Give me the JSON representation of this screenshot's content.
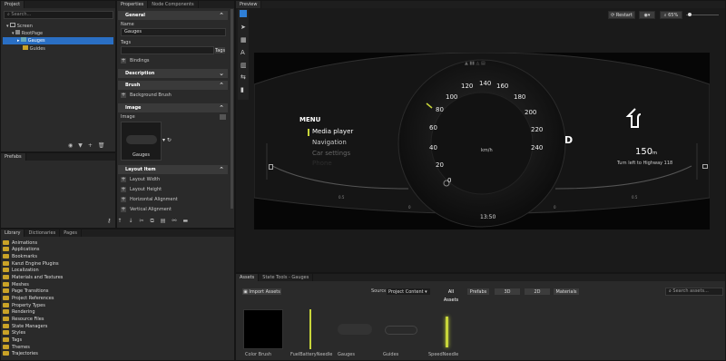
{
  "project": {
    "tab": "Project",
    "search_placeholder": "Search...",
    "tree": [
      {
        "label": "Screen"
      },
      {
        "label": "RootPage"
      },
      {
        "label": "Gauges"
      },
      {
        "label": "Guides"
      }
    ],
    "prefabs_tab": "Prefabs"
  },
  "properties": {
    "tabs": [
      "Properties",
      "Node Components"
    ],
    "general_header": "General",
    "name_label": "Name",
    "name_value": "Gauges",
    "tags_label": "Tags",
    "tags_button": "Tags",
    "bindings": "Bindings",
    "description_header": "Description",
    "brush_header": "Brush",
    "background_brush": "Background Brush",
    "image_header": "Image",
    "image_label": "Image",
    "image_value": "Gauges",
    "layout_header": "Layout Item",
    "layout_items": [
      "Layout Width",
      "Layout Height",
      "Horizontal Alignment",
      "Vertical Alignment"
    ]
  },
  "preview": {
    "tab": "Preview",
    "restart": "Restart",
    "zoom": "65%",
    "menu_title": "MENU",
    "menu_items": [
      "Media player",
      "Navigation",
      "Car settings",
      "Phone"
    ],
    "speed_ticks": [
      "0",
      "20",
      "40",
      "60",
      "80",
      "100",
      "120",
      "140",
      "160",
      "180",
      "200",
      "220",
      "240"
    ],
    "unit": "km/h",
    "gear": "D",
    "nav_distance": "150",
    "nav_unit": "m",
    "nav_text": "Turn left to Highway 118",
    "clock": "13:50",
    "left_scale": [
      "0.5",
      "0"
    ],
    "right_scale": [
      "0.5",
      "0"
    ]
  },
  "library": {
    "tabs": [
      "Library",
      "Dictionaries",
      "Pages"
    ],
    "items": [
      "Animations",
      "Applications",
      "Bookmarks",
      "Kanzi Engine Plugins",
      "Localization",
      "Materials and Textures",
      "Meshes",
      "Page Transitions",
      "Project References",
      "Property Types",
      "Rendering",
      "Resource Files",
      "State Managers",
      "Styles",
      "Tags",
      "Themes",
      "Trajectories"
    ]
  },
  "assets": {
    "tabs": [
      "Assets",
      "State Tools - Gauges"
    ],
    "import": "Import Assets",
    "source_label": "Source",
    "source_value": "Project Content",
    "filters": [
      "All Assets",
      "Prefabs",
      "3D",
      "2D",
      "Materials"
    ],
    "search_placeholder": "Search assets...",
    "items": [
      "Color Brush",
      "FuelBatteryNeedle",
      "Gauges",
      "Guides",
      "SpeedNeedle"
    ]
  },
  "colors": {
    "accent": "#2f7fd6",
    "needle": "#c8d63a",
    "selection": "#2a6fc4"
  }
}
